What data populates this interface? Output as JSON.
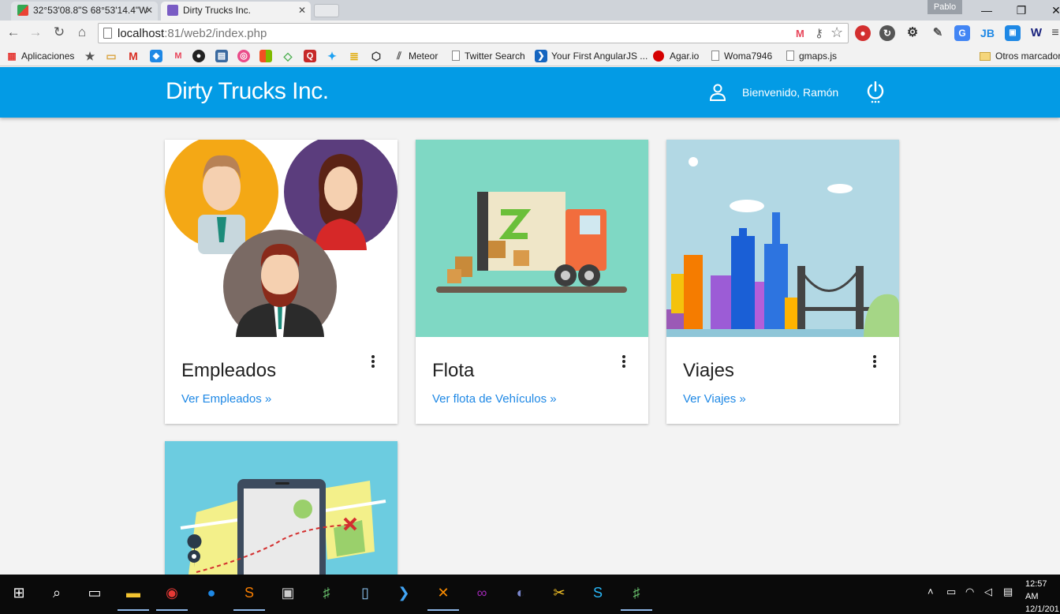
{
  "browser": {
    "tabs": [
      {
        "label": "32°53'08.8\"S 68°53'14.4\"W",
        "active": false
      },
      {
        "label": "Dirty Trucks Inc.",
        "active": true
      }
    ],
    "profile": "Pablo",
    "url_host": "localhost",
    "url_path": ":81/web2/index.php",
    "bookmarks": [
      {
        "label": "Aplicaciones"
      },
      {
        "label": "Meteor"
      },
      {
        "label": "Twitter Search"
      },
      {
        "label": "Your First AngularJS ..."
      },
      {
        "label": "Agar.io"
      },
      {
        "label": "Woma7946"
      },
      {
        "label": "gmaps.js"
      },
      {
        "label": "Otros marcadores"
      }
    ]
  },
  "app": {
    "brand": "Dirty Trucks Inc.",
    "welcome": "Bienvenido, Ramón",
    "accent": "#039be5",
    "link_color": "#1e88e5"
  },
  "cards": [
    {
      "title": "Empleados",
      "link": "Ver Empleados »",
      "image": "employees-avatars-illustration"
    },
    {
      "title": "Flota",
      "link": "Ver flota de Vehículos »",
      "image": "delivery-truck-illustration"
    },
    {
      "title": "Viajes",
      "link": "Ver Viajes »",
      "image": "city-skyline-illustration"
    },
    {
      "title": "",
      "link": "",
      "image": "phone-map-illustration"
    }
  ],
  "taskbar": {
    "time": "12:57 AM",
    "date": "12/1/201"
  }
}
